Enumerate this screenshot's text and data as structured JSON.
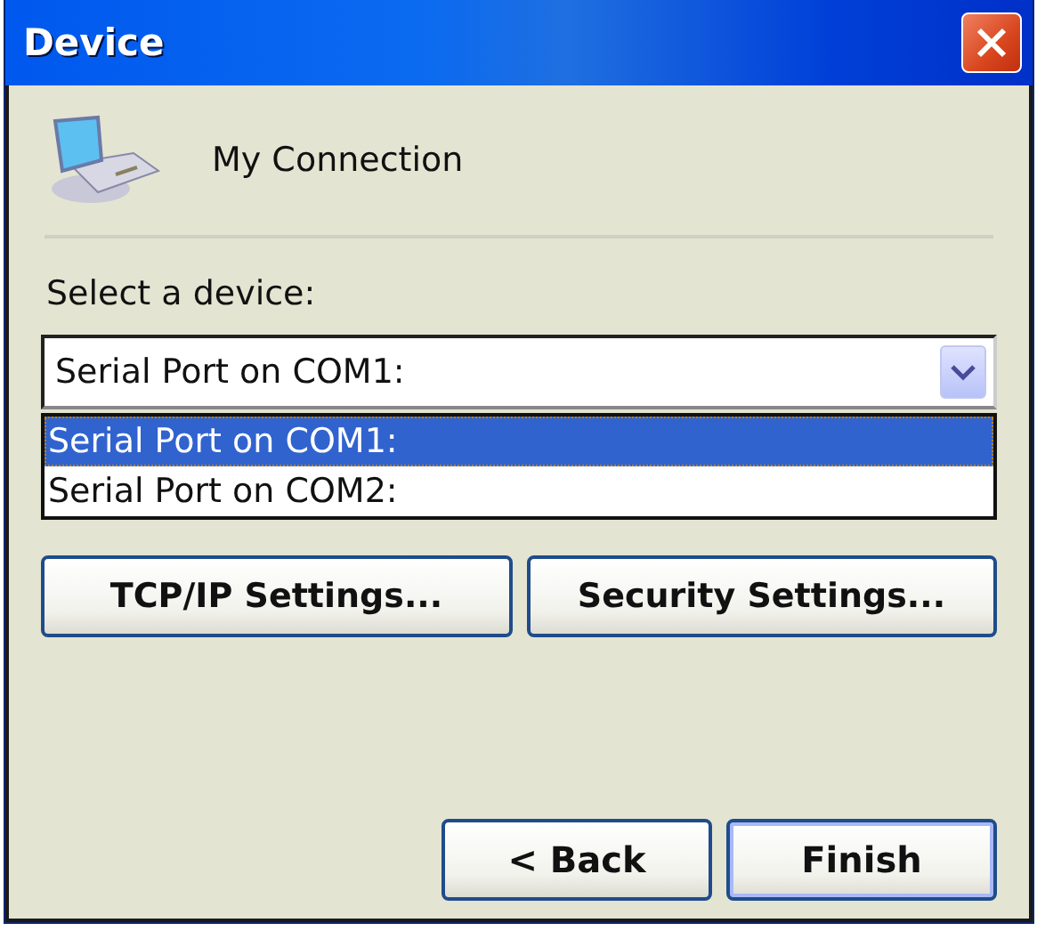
{
  "window": {
    "title": "Device"
  },
  "connection": {
    "name": "My Connection"
  },
  "device_label": "Select a device:",
  "device_combo": {
    "value": "Serial Port on COM1:",
    "expanded": true,
    "options": [
      {
        "label": "Serial Port on COM1:",
        "selected": true
      },
      {
        "label": "Serial Port on COM2:",
        "selected": false
      }
    ]
  },
  "settings_buttons": [
    {
      "label": "TCP/IP Settings..."
    },
    {
      "label": "Security Settings..."
    }
  ],
  "nav_buttons": [
    {
      "label": "< Back",
      "default": false
    },
    {
      "label": "Finish",
      "default": true
    }
  ]
}
